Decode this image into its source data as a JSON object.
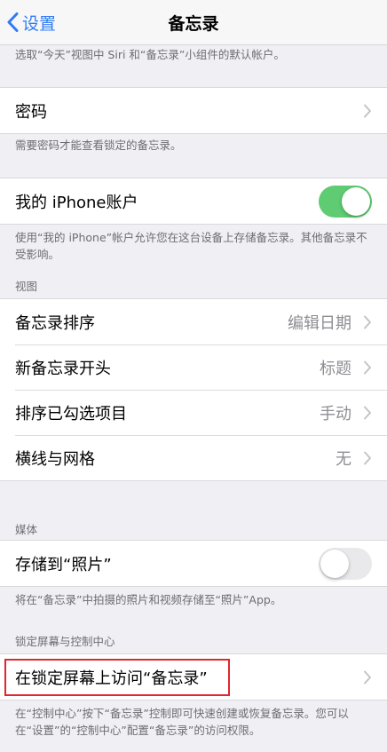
{
  "nav": {
    "back_label": "设置",
    "title": "备忘录",
    "back_icon": "chevron-left-icon",
    "accent": "#2f7cf6"
  },
  "notes": {
    "default_account": "选取“今天”视图中 Siri 和“备忘录”小组件的默认帐户。",
    "password": "需要密码才能查看锁定的备忘录。",
    "iphone_account": "使用“我的 iPhone”帐户允许您在这台设备上存储备忘录。其他备忘录不受影响。",
    "media": "将在“备忘录”中拍摄的照片和视频存储至“照片”App。",
    "lockscreen": "在“控制中心”按下“备忘录”控制即可快速创建或恢复备忘录。您可以在“设置”的“控制中心”配置“备忘录”的访问权限。"
  },
  "sections": {
    "view_header": "视图",
    "media_header": "媒体",
    "lockscreen_header": "锁定屏幕与控制中心"
  },
  "password_cell": {
    "label": "密码"
  },
  "iphone_account_cell": {
    "label": "我的 iPhone账户",
    "switch_on": true
  },
  "view_cells": [
    {
      "label": "备忘录排序",
      "value": "编辑日期"
    },
    {
      "label": "新备忘录开头",
      "value": "标题"
    },
    {
      "label": "排序已勾选项目",
      "value": "手动"
    },
    {
      "label": "横线与网格",
      "value": "无"
    }
  ],
  "save_to_photos_cell": {
    "label": "存储到“照片”",
    "switch_on": false
  },
  "lockscreen_cell": {
    "label": "在锁定屏幕上访问“备忘录”"
  },
  "colors": {
    "switch_on": "#5fcb72",
    "highlight": "#e0262e",
    "background": "#efeff4"
  }
}
